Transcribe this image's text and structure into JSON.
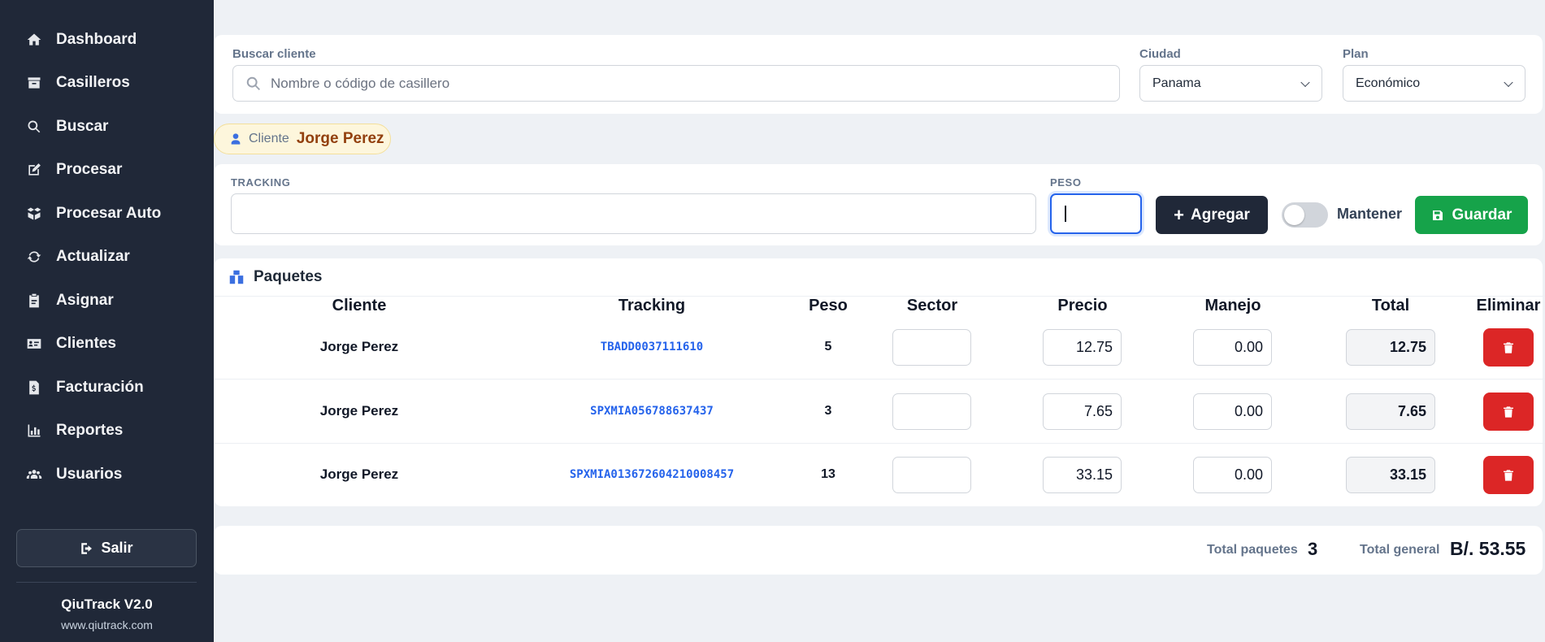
{
  "sidebar": {
    "items": [
      {
        "label": "Dashboard",
        "icon": "home-icon"
      },
      {
        "label": "Casilleros",
        "icon": "archive-icon"
      },
      {
        "label": "Buscar",
        "icon": "search-icon"
      },
      {
        "label": "Procesar",
        "icon": "edit-icon"
      },
      {
        "label": "Procesar Auto",
        "icon": "boxes-icon"
      },
      {
        "label": "Actualizar",
        "icon": "refresh-icon"
      },
      {
        "label": "Asignar",
        "icon": "clipboard-icon"
      },
      {
        "label": "Clientes",
        "icon": "id-card-icon"
      },
      {
        "label": "Facturación",
        "icon": "invoice-icon"
      },
      {
        "label": "Reportes",
        "icon": "chart-icon"
      },
      {
        "label": "Usuarios",
        "icon": "users-icon"
      }
    ],
    "logout_label": "Salir",
    "brand": "QiuTrack V2.0",
    "url": "www.qiutrack.com"
  },
  "filters": {
    "search_label": "Buscar cliente",
    "search_placeholder": "Nombre o código de casillero",
    "city_label": "Ciudad",
    "city_value": "Panama",
    "plan_label": "Plan",
    "plan_value": "Económico"
  },
  "client": {
    "key": "Cliente",
    "name": "Jorge Perez"
  },
  "entry": {
    "tracking_label": "TRACKING",
    "tracking_value": "",
    "peso_label": "PESO",
    "peso_value": "",
    "add_label": "Agregar",
    "keep_label": "Mantener",
    "keep_on": false,
    "save_label": "Guardar"
  },
  "packages": {
    "title": "Paquetes",
    "columns": [
      "Cliente",
      "Tracking",
      "Peso",
      "Sector",
      "Precio",
      "Manejo",
      "Total",
      "Eliminar"
    ],
    "rows": [
      {
        "cliente": "Jorge Perez",
        "tracking": "TBADD0037111610",
        "peso": "5",
        "sector": "",
        "precio": "12.75",
        "manejo": "0.00",
        "total": "12.75"
      },
      {
        "cliente": "Jorge Perez",
        "tracking": "SPXMIA056788637437",
        "peso": "3",
        "sector": "",
        "precio": "7.65",
        "manejo": "0.00",
        "total": "7.65"
      },
      {
        "cliente": "Jorge Perez",
        "tracking": "SPXMIA013672604210008457",
        "peso": "13",
        "sector": "",
        "precio": "33.15",
        "manejo": "0.00",
        "total": "33.15"
      }
    ]
  },
  "summary": {
    "count_label": "Total paquetes",
    "count_value": "3",
    "total_label": "Total general",
    "total_value": "B/. 53.55"
  }
}
